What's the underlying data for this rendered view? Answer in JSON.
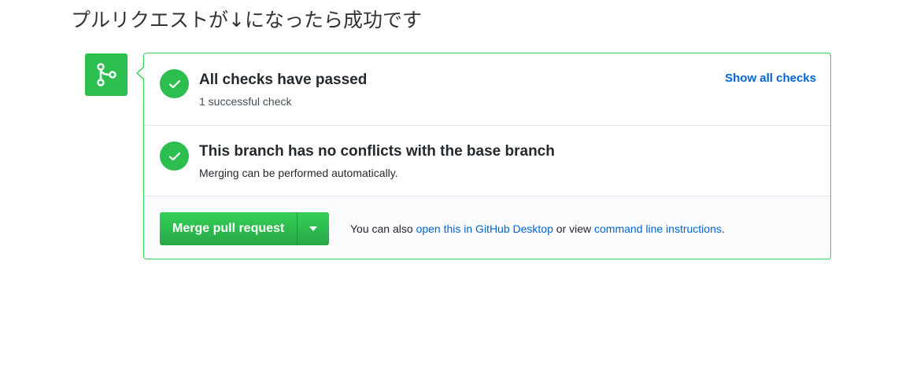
{
  "caption": "プルリクエストが↓になったら成功です",
  "icons": {
    "merge": "git-merge-icon",
    "check": "check-icon",
    "caret": "triangle-down-icon"
  },
  "colors": {
    "green": "#2cbe4e",
    "link": "#0366d6",
    "border": "#34d058"
  },
  "checks": {
    "title": "All checks have passed",
    "subtitle": "1 successful check",
    "show_all": "Show all checks"
  },
  "conflicts": {
    "title": "This branch has no conflicts with the base branch",
    "subtitle": "Merging can be performed automatically."
  },
  "merge": {
    "button_label": "Merge pull request",
    "also_prefix": "You can also ",
    "desktop_link": "open this in GitHub Desktop",
    "or_view": " or view ",
    "cli_link": "command line instructions",
    "suffix": "."
  }
}
